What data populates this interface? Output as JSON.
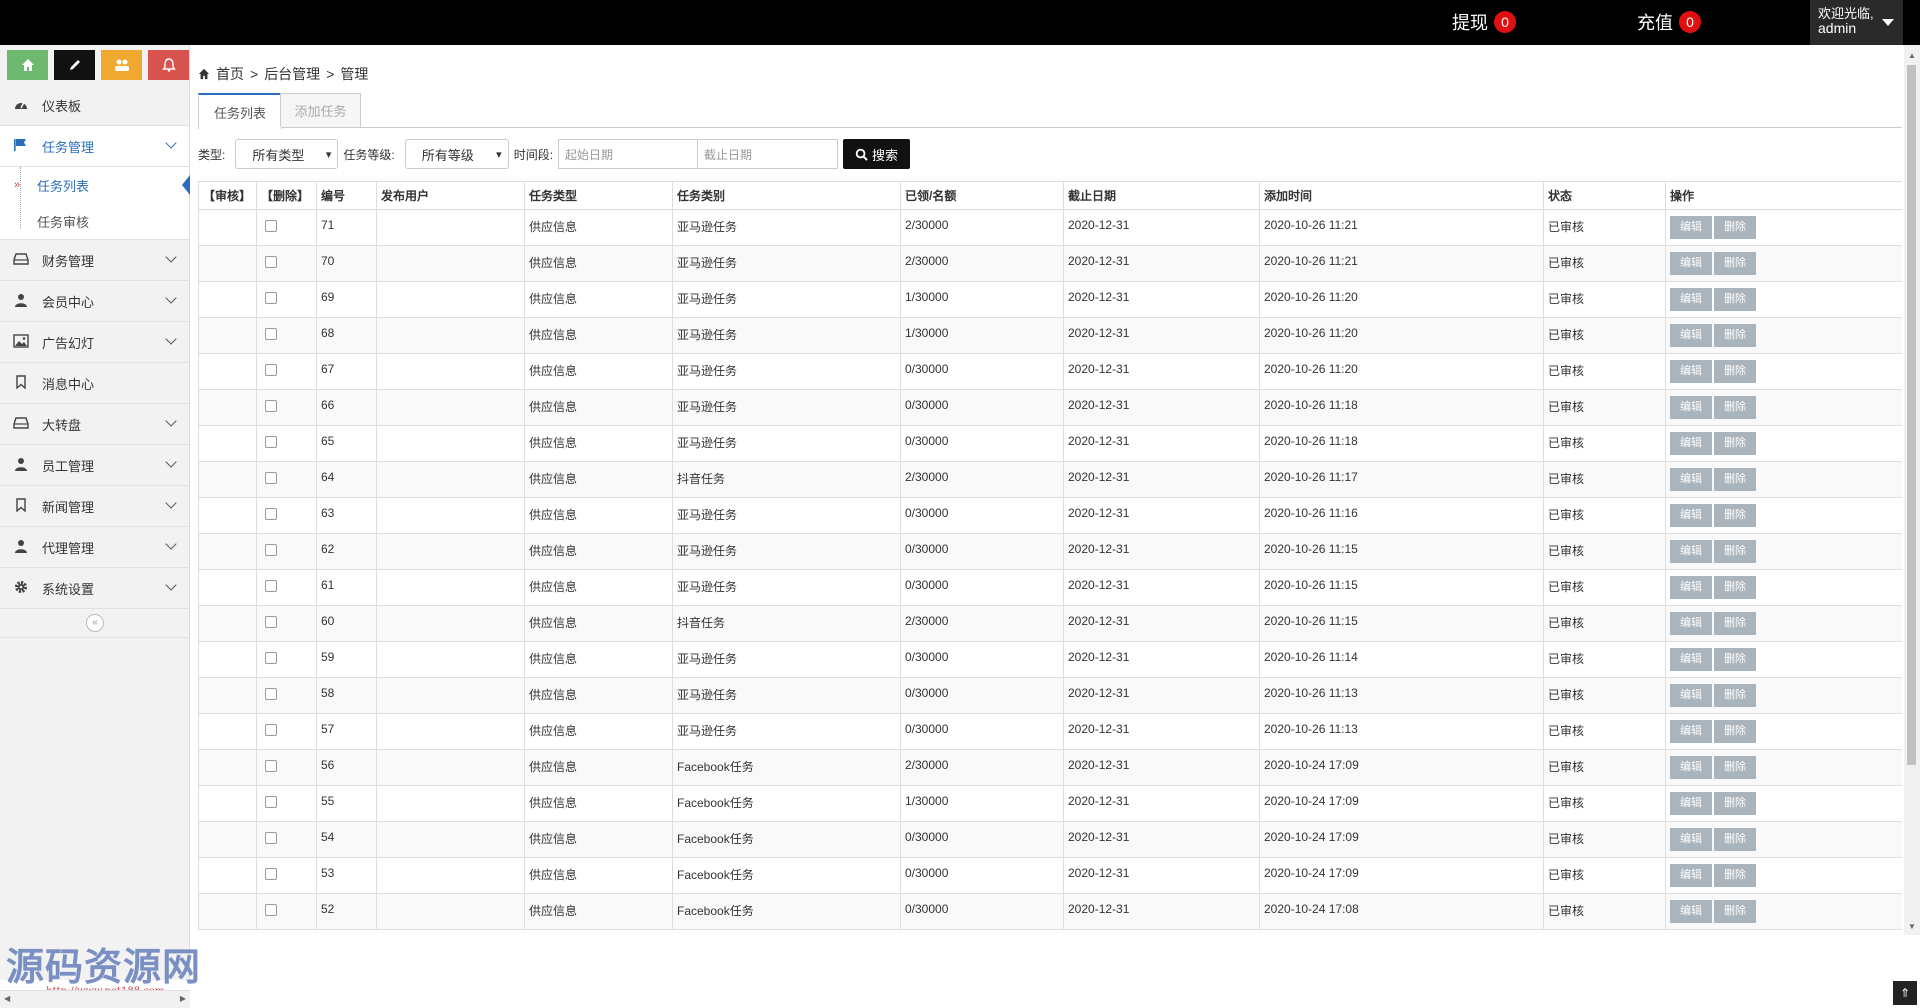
{
  "topbar": {
    "withdraw_label": "提现",
    "withdraw_count": "0",
    "recharge_label": "充值",
    "recharge_count": "0",
    "welcome": "欢迎光临,",
    "username": "admin"
  },
  "quick_buttons": [
    "home-icon",
    "pencil-icon",
    "group-icon",
    "bell-icon"
  ],
  "sidebar": {
    "items": [
      {
        "label": "仪表板",
        "icon": "dashboard-icon"
      },
      {
        "label": "任务管理",
        "icon": "flag-icon"
      },
      {
        "label": "财务管理",
        "icon": "drive-icon"
      },
      {
        "label": "会员中心",
        "icon": "user-icon"
      },
      {
        "label": "广告幻灯",
        "icon": "picture-icon"
      },
      {
        "label": "消息中心",
        "icon": "bookmark-icon"
      },
      {
        "label": "大转盘",
        "icon": "drive-icon"
      },
      {
        "label": "员工管理",
        "icon": "user-icon"
      },
      {
        "label": "新闻管理",
        "icon": "bookmark-icon"
      },
      {
        "label": "代理管理",
        "icon": "user-icon"
      },
      {
        "label": "系统设置",
        "icon": "gear-icon"
      }
    ],
    "subitems": [
      {
        "label": "任务列表"
      },
      {
        "label": "任务审核"
      }
    ]
  },
  "breadcrumb": {
    "home": "首页",
    "sep": ">",
    "level1": "后台管理",
    "level2": "管理"
  },
  "tabs": [
    {
      "label": "任务列表"
    },
    {
      "label": "添加任务"
    }
  ],
  "filter": {
    "type_label": "类型:",
    "type_value": "所有类型",
    "level_label": "任务等级:",
    "level_value": "所有等级",
    "period_label": "时间段:",
    "start_placeholder": "起始日期",
    "end_placeholder": "截止日期",
    "search_label": "搜索"
  },
  "table": {
    "headers": [
      "【审核】",
      "【删除】",
      "编号",
      "发布用户",
      "任务类型",
      "任务类别",
      "已领/名额",
      "截止日期",
      "添加时间",
      "状态",
      "操作"
    ],
    "edit_label": "编辑",
    "delete_label": "删除",
    "rows": [
      {
        "id": "71",
        "type": "供应信息",
        "category": "亚马逊任务",
        "quota": "2/30000",
        "deadline": "2020-12-31",
        "added": "2020-10-26 11:21",
        "status": "已审核"
      },
      {
        "id": "70",
        "type": "供应信息",
        "category": "亚马逊任务",
        "quota": "2/30000",
        "deadline": "2020-12-31",
        "added": "2020-10-26 11:21",
        "status": "已审核"
      },
      {
        "id": "69",
        "type": "供应信息",
        "category": "亚马逊任务",
        "quota": "1/30000",
        "deadline": "2020-12-31",
        "added": "2020-10-26 11:20",
        "status": "已审核"
      },
      {
        "id": "68",
        "type": "供应信息",
        "category": "亚马逊任务",
        "quota": "1/30000",
        "deadline": "2020-12-31",
        "added": "2020-10-26 11:20",
        "status": "已审核"
      },
      {
        "id": "67",
        "type": "供应信息",
        "category": "亚马逊任务",
        "quota": "0/30000",
        "deadline": "2020-12-31",
        "added": "2020-10-26 11:20",
        "status": "已审核"
      },
      {
        "id": "66",
        "type": "供应信息",
        "category": "亚马逊任务",
        "quota": "0/30000",
        "deadline": "2020-12-31",
        "added": "2020-10-26 11:18",
        "status": "已审核"
      },
      {
        "id": "65",
        "type": "供应信息",
        "category": "亚马逊任务",
        "quota": "0/30000",
        "deadline": "2020-12-31",
        "added": "2020-10-26 11:18",
        "status": "已审核"
      },
      {
        "id": "64",
        "type": "供应信息",
        "category": "抖音任务",
        "quota": "2/30000",
        "deadline": "2020-12-31",
        "added": "2020-10-26 11:17",
        "status": "已审核"
      },
      {
        "id": "63",
        "type": "供应信息",
        "category": "亚马逊任务",
        "quota": "0/30000",
        "deadline": "2020-12-31",
        "added": "2020-10-26 11:16",
        "status": "已审核"
      },
      {
        "id": "62",
        "type": "供应信息",
        "category": "亚马逊任务",
        "quota": "0/30000",
        "deadline": "2020-12-31",
        "added": "2020-10-26 11:15",
        "status": "已审核"
      },
      {
        "id": "61",
        "type": "供应信息",
        "category": "亚马逊任务",
        "quota": "0/30000",
        "deadline": "2020-12-31",
        "added": "2020-10-26 11:15",
        "status": "已审核"
      },
      {
        "id": "60",
        "type": "供应信息",
        "category": "抖音任务",
        "quota": "2/30000",
        "deadline": "2020-12-31",
        "added": "2020-10-26 11:15",
        "status": "已审核"
      },
      {
        "id": "59",
        "type": "供应信息",
        "category": "亚马逊任务",
        "quota": "0/30000",
        "deadline": "2020-12-31",
        "added": "2020-10-26 11:14",
        "status": "已审核"
      },
      {
        "id": "58",
        "type": "供应信息",
        "category": "亚马逊任务",
        "quota": "0/30000",
        "deadline": "2020-12-31",
        "added": "2020-10-26 11:13",
        "status": "已审核"
      },
      {
        "id": "57",
        "type": "供应信息",
        "category": "亚马逊任务",
        "quota": "0/30000",
        "deadline": "2020-12-31",
        "added": "2020-10-26 11:13",
        "status": "已审核"
      },
      {
        "id": "56",
        "type": "供应信息",
        "category": "Facebook任务",
        "quota": "2/30000",
        "deadline": "2020-12-31",
        "added": "2020-10-24 17:09",
        "status": "已审核"
      },
      {
        "id": "55",
        "type": "供应信息",
        "category": "Facebook任务",
        "quota": "1/30000",
        "deadline": "2020-12-31",
        "added": "2020-10-24 17:09",
        "status": "已审核"
      },
      {
        "id": "54",
        "type": "供应信息",
        "category": "Facebook任务",
        "quota": "0/30000",
        "deadline": "2020-12-31",
        "added": "2020-10-24 17:09",
        "status": "已审核"
      },
      {
        "id": "53",
        "type": "供应信息",
        "category": "Facebook任务",
        "quota": "0/30000",
        "deadline": "2020-12-31",
        "added": "2020-10-24 17:09",
        "status": "已审核"
      },
      {
        "id": "52",
        "type": "供应信息",
        "category": "Facebook任务",
        "quota": "0/30000",
        "deadline": "2020-12-31",
        "added": "2020-10-24 17:08",
        "status": "已审核"
      }
    ]
  },
  "watermark": {
    "text": "源码资源网",
    "url": "http://www.net188.com"
  }
}
